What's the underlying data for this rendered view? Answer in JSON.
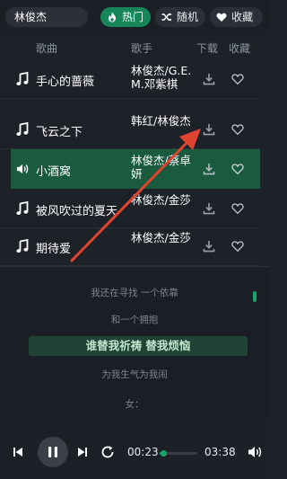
{
  "search": {
    "value": "林俊杰"
  },
  "tabs": [
    {
      "label": "热门",
      "icon": "fire-icon",
      "active": true
    },
    {
      "label": "随机",
      "icon": "shuffle-icon",
      "active": false
    },
    {
      "label": "收藏",
      "icon": "heart-icon",
      "active": false
    }
  ],
  "table": {
    "headers": {
      "song": "歌曲",
      "artist": "歌手",
      "download": "下载",
      "favorite": "收藏"
    },
    "rows": [
      {
        "title": "手心的蔷薇",
        "artist": "林俊杰/G.E.M.邓紫棋",
        "playing": false
      },
      {
        "title": "飞云之下",
        "artist": "韩红/林俊杰",
        "playing": false
      },
      {
        "title": "小酒窝",
        "artist": "林俊杰/蔡卓妍",
        "playing": true
      },
      {
        "title": "被风吹过的夏天",
        "artist": "林俊杰/金莎",
        "playing": false
      },
      {
        "title": "期待爱",
        "artist": "林俊杰/金莎",
        "playing": false
      }
    ]
  },
  "lyrics": [
    "我还在寻找 一个依靠",
    "和一个拥抱",
    "谁替我祈祷 替我烦恼",
    "为我生气为我闹",
    "女："
  ],
  "player": {
    "current_time": "00:23",
    "total_time": "03:38",
    "progress": 0.105
  },
  "colors": {
    "accent": "#19a468",
    "active_row": "#1a5a3f",
    "annotation_arrow": "#e0432f"
  }
}
